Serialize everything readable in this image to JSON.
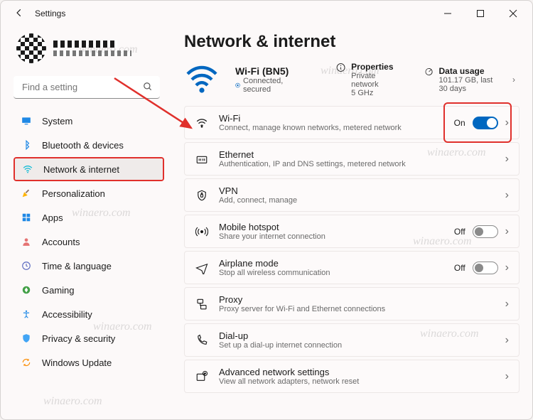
{
  "window_title": "Settings",
  "search_placeholder": "Find a setting",
  "page_title": "Network & internet",
  "sidebar": {
    "items": [
      {
        "label": "System"
      },
      {
        "label": "Bluetooth & devices"
      },
      {
        "label": "Network & internet"
      },
      {
        "label": "Personalization"
      },
      {
        "label": "Apps"
      },
      {
        "label": "Accounts"
      },
      {
        "label": "Time & language"
      },
      {
        "label": "Gaming"
      },
      {
        "label": "Accessibility"
      },
      {
        "label": "Privacy & security"
      },
      {
        "label": "Windows Update"
      }
    ]
  },
  "hero": {
    "ssid": "Wi-Fi (BN5)",
    "status": "Connected, secured",
    "props_title": "Properties",
    "props_detail": "Private network\n5 GHz",
    "usage_title": "Data usage",
    "usage_detail": "101.17 GB, last 30 days"
  },
  "rows": {
    "wifi": {
      "title": "Wi-Fi",
      "desc": "Connect, manage known networks, metered network",
      "state": "On"
    },
    "eth": {
      "title": "Ethernet",
      "desc": "Authentication, IP and DNS settings, metered network"
    },
    "vpn": {
      "title": "VPN",
      "desc": "Add, connect, manage"
    },
    "hotspot": {
      "title": "Mobile hotspot",
      "desc": "Share your internet connection",
      "state": "Off"
    },
    "air": {
      "title": "Airplane mode",
      "desc": "Stop all wireless communication",
      "state": "Off"
    },
    "proxy": {
      "title": "Proxy",
      "desc": "Proxy server for Wi-Fi and Ethernet connections"
    },
    "dial": {
      "title": "Dial-up",
      "desc": "Set up a dial-up internet connection"
    },
    "adv": {
      "title": "Advanced network settings",
      "desc": "View all network adapters, network reset"
    }
  },
  "watermark": "winaero.com"
}
